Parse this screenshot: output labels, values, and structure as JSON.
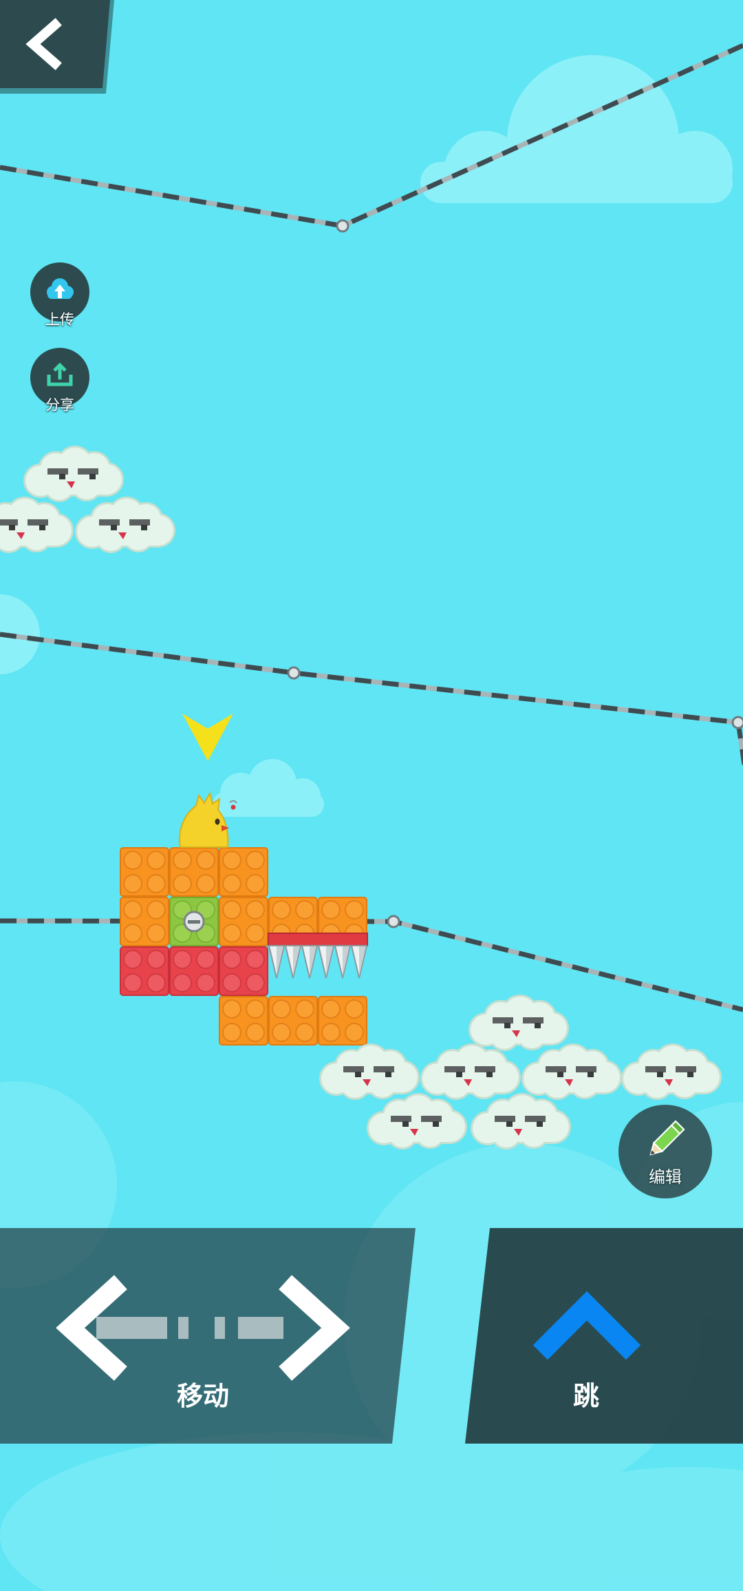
{
  "hud": {
    "back": {
      "icon": "chevron-left-icon"
    },
    "upload": {
      "label": "上传",
      "icon": "cloud-upload-icon"
    },
    "share": {
      "label": "分享",
      "icon": "share-upload-icon"
    },
    "edit": {
      "label": "编辑",
      "icon": "pencil-icon"
    }
  },
  "controls": {
    "move": {
      "label": "移动",
      "icon": "left-right-arrows-icon"
    },
    "jump": {
      "label": "跳",
      "icon": "chevron-up-icon"
    }
  },
  "colors": {
    "sky": "#5fe5f3",
    "hud_panel": "#2d4a4e",
    "jump_arrow": "#0a86f2",
    "upload_icon": "#33c7ee",
    "share_icon": "#3fd4aa",
    "pencil_icon": "#7bd64e",
    "block_orange": "#f7931e",
    "block_red": "#e8434b",
    "block_green": "#8dc641",
    "player_yellow": "#f4d22a",
    "pointer_yellow": "#f4e11c"
  }
}
